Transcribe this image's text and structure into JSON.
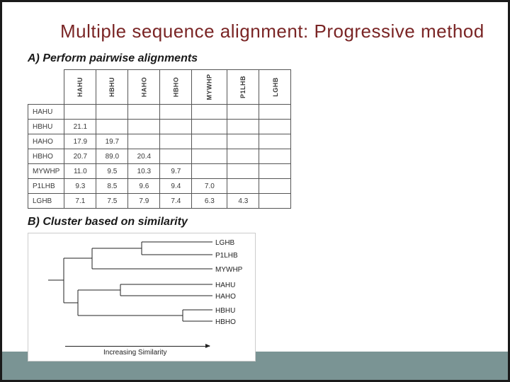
{
  "title": "Multiple  sequence alignment: Progressive method",
  "sectionA": "A) Perform pairwise alignments",
  "sectionB": "B) Cluster based on similarity",
  "headers": [
    "HAHU",
    "HBHU",
    "HAHO",
    "HBHO",
    "MYWHP",
    "P1LHB",
    "LGHB"
  ],
  "rows": [
    {
      "label": "HAHU",
      "cells": [
        "",
        "",
        "",
        "",
        "",
        "",
        ""
      ]
    },
    {
      "label": "HBHU",
      "cells": [
        "21.1",
        "",
        "",
        "",
        "",
        "",
        ""
      ]
    },
    {
      "label": "HAHO",
      "cells": [
        "17.9",
        "19.7",
        "",
        "",
        "",
        "",
        ""
      ]
    },
    {
      "label": "HBHO",
      "cells": [
        "20.7",
        "89.0",
        "20.4",
        "",
        "",
        "",
        ""
      ]
    },
    {
      "label": "MYWHP",
      "cells": [
        "11.0",
        "9.5",
        "10.3",
        "9.7",
        "",
        "",
        ""
      ]
    },
    {
      "label": "P1LHB",
      "cells": [
        "9.3",
        "8.5",
        "9.6",
        "9.4",
        "7.0",
        "",
        ""
      ]
    },
    {
      "label": "LGHB",
      "cells": [
        "7.1",
        "7.5",
        "7.9",
        "7.4",
        "6.3",
        "4.3",
        ""
      ]
    }
  ],
  "dendroLabels": [
    "LGHB",
    "P1LHB",
    "MYWHP",
    "HAHU",
    "HAHO",
    "HBHU",
    "HBHO"
  ],
  "axisLabel": "Increasing Similarity"
}
